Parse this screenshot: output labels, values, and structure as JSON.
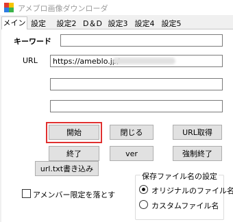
{
  "window": {
    "title": "アメブロ画像ダウンローダ"
  },
  "tabs": [
    {
      "label": "メイン",
      "active": true
    },
    {
      "label": "設定"
    },
    {
      "label": "設定2"
    },
    {
      "label": "D＆D"
    },
    {
      "label": "設定3"
    },
    {
      "label": "設定4"
    },
    {
      "label": "設定5"
    }
  ],
  "main": {
    "keyword_label": "キーワード",
    "keyword_value": "",
    "url_label": "URL",
    "url_value": "https://ameblo.jp/",
    "field3_value": "",
    "field4_value": ""
  },
  "buttons": {
    "start": "開始",
    "close": "閉じる",
    "url_get": "URL取得",
    "end": "終了",
    "ver": "ver",
    "force_end": "強制終了",
    "url_txt_write": "url.txt書き込み"
  },
  "save_filename": {
    "title": "保存ファイル名の設定",
    "options": [
      {
        "label": "オリジナルのファイル名",
        "selected": true
      },
      {
        "label": "カスタムファイル名",
        "selected": false
      }
    ]
  },
  "member_limited": {
    "label": "アメンバー限定を落とす",
    "checked": false
  },
  "colors": {
    "highlight": "#e0302f",
    "button_face": "#e1e1e1",
    "button_border": "#adadad"
  }
}
